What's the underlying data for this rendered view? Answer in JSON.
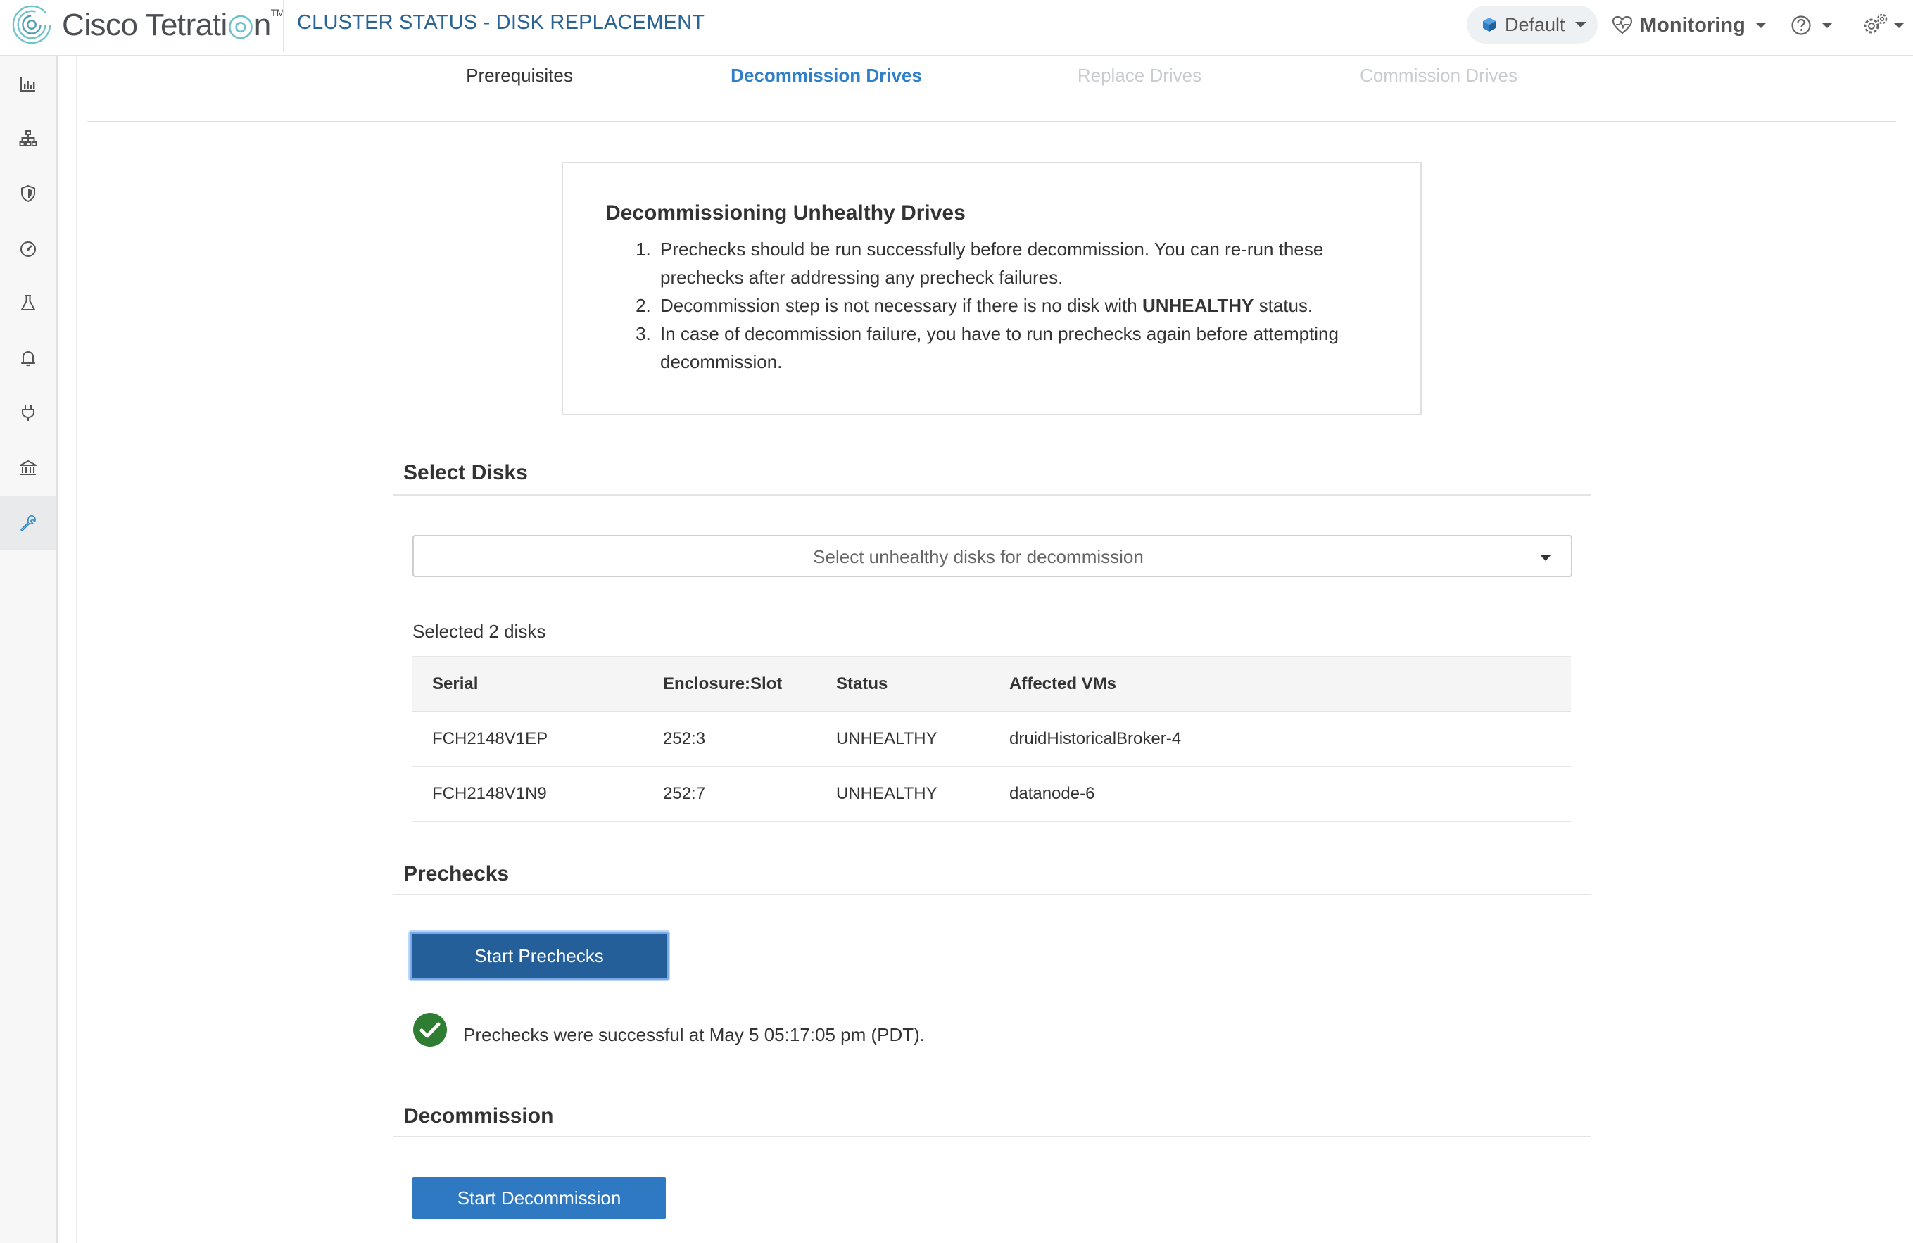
{
  "header": {
    "logo_text": "Cisco Tetrati",
    "logo_text_end": "n",
    "logo_tm": "TM",
    "page_title": "CLUSTER STATUS - DISK REPLACEMENT",
    "scope_label": "Default",
    "monitoring_label": "Monitoring"
  },
  "sidebar": {
    "items": [
      {
        "icon": "bar-chart-icon"
      },
      {
        "icon": "topology-icon"
      },
      {
        "icon": "shield-icon"
      },
      {
        "icon": "dashboard-gauge-icon"
      },
      {
        "icon": "flask-icon"
      },
      {
        "icon": "bell-icon"
      },
      {
        "icon": "plug-icon"
      },
      {
        "icon": "bank-icon"
      },
      {
        "icon": "wrench-icon",
        "active": true
      }
    ]
  },
  "steps": [
    {
      "label": "Prerequisites",
      "state": "done"
    },
    {
      "label": "Decommission Drives",
      "state": "active"
    },
    {
      "label": "Replace Drives",
      "state": "future"
    },
    {
      "label": "Commission Drives",
      "state": "future"
    }
  ],
  "info": {
    "title": "Decommissioning Unhealthy Drives",
    "item1": "Prechecks should be run successfully before decommission. You can re-run these prechecks after addressing any precheck failures.",
    "item2_before": "Decommission step is not necessary if there is no disk with ",
    "item2_bold": "UNHEALTHY",
    "item2_after": " status.",
    "item3": "In case of decommission failure, you have to run prechecks again before attempting decommission."
  },
  "select_disks": {
    "title": "Select Disks",
    "placeholder": "Select unhealthy disks for decommission",
    "selected_count": "Selected 2 disks",
    "columns": [
      "Serial",
      "Enclosure:Slot",
      "Status",
      "Affected VMs"
    ],
    "rows": [
      {
        "serial": "FCH2148V1EP",
        "slot": "252:3",
        "status": "UNHEALTHY",
        "vms": "druidHistoricalBroker-4"
      },
      {
        "serial": "FCH2148V1N9",
        "slot": "252:7",
        "status": "UNHEALTHY",
        "vms": "datanode-6"
      }
    ]
  },
  "prechecks": {
    "title": "Prechecks",
    "button_label": "Start Prechecks",
    "result_message": "Prechecks were successful at May 5 05:17:05 pm (PDT)."
  },
  "decommission": {
    "title": "Decommission",
    "button_label": "Start Decommission"
  },
  "colors": {
    "accent": "#2f80c8",
    "title_blue": "#2a6496",
    "button_dark": "#245f9a",
    "button": "#2f79c2",
    "success": "#2e7d32"
  }
}
